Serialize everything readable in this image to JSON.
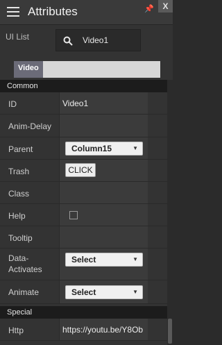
{
  "header": {
    "title": "Attributes",
    "pin_icon": "pin-icon",
    "close_label": "X"
  },
  "uilist": {
    "label": "UI List",
    "value": "Video1"
  },
  "tabs": {
    "video": "Video"
  },
  "sections": {
    "common": "Common",
    "special": "Special"
  },
  "rows": {
    "id": {
      "label": "ID",
      "value": "Video1"
    },
    "anim_delay": {
      "label": "Anim-Delay"
    },
    "parent": {
      "label": "Parent",
      "value": "Column15"
    },
    "trash": {
      "label": "Trash",
      "button": "CLICK"
    },
    "class": {
      "label": "Class"
    },
    "help": {
      "label": "Help"
    },
    "tooltip": {
      "label": "Tooltip"
    },
    "data_activates": {
      "label_line1": "Data-",
      "label_line2": "Activates",
      "value": "Select"
    },
    "animate": {
      "label": "Animate",
      "value": "Select"
    },
    "http": {
      "label": "Http",
      "value": "https://youtu.be/Y8Ob"
    }
  }
}
